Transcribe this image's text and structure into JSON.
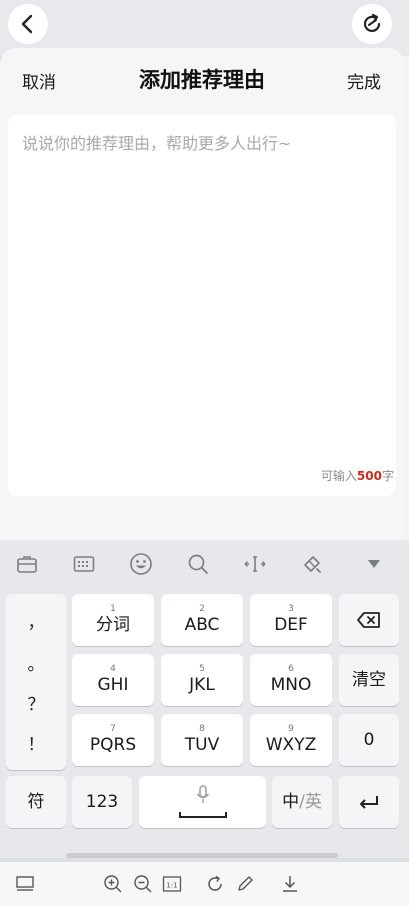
{
  "sheet": {
    "cancel_label": "取消",
    "title": "添加推荐理由",
    "done_label": "完成",
    "input": {
      "placeholder": "说说你的推荐理由，帮助更多人出行~",
      "counter_prefix": "可输入",
      "counter_value": "500",
      "counter_suffix": "字"
    }
  },
  "keyboard": {
    "toolbar_icons": [
      "briefcase-icon",
      "keyboard-icon",
      "emoji-icon",
      "search-icon",
      "cursor-move-icon",
      "brush-icon",
      "collapse-icon"
    ],
    "punctuation": [
      "，",
      "。",
      "？",
      "！"
    ],
    "keys": [
      {
        "sup": "1",
        "label": "分词"
      },
      {
        "sup": "2",
        "label": "ABC"
      },
      {
        "sup": "3",
        "label": "DEF"
      },
      {
        "sup": "4",
        "label": "GHI"
      },
      {
        "sup": "5",
        "label": "JKL"
      },
      {
        "sup": "6",
        "label": "MNO"
      },
      {
        "sup": "7",
        "label": "PQRS"
      },
      {
        "sup": "8",
        "label": "TUV"
      },
      {
        "sup": "9",
        "label": "WXYZ"
      }
    ],
    "clear_label": "清空",
    "zero_label": "0",
    "symbol_label": "符",
    "num_label": "123",
    "lang_label_zh": "中",
    "lang_label_sep": "/",
    "lang_label_en": "英"
  },
  "colors": {
    "accent_red": "#cc2b1d",
    "placeholder_grey": "#a9a9a9"
  }
}
